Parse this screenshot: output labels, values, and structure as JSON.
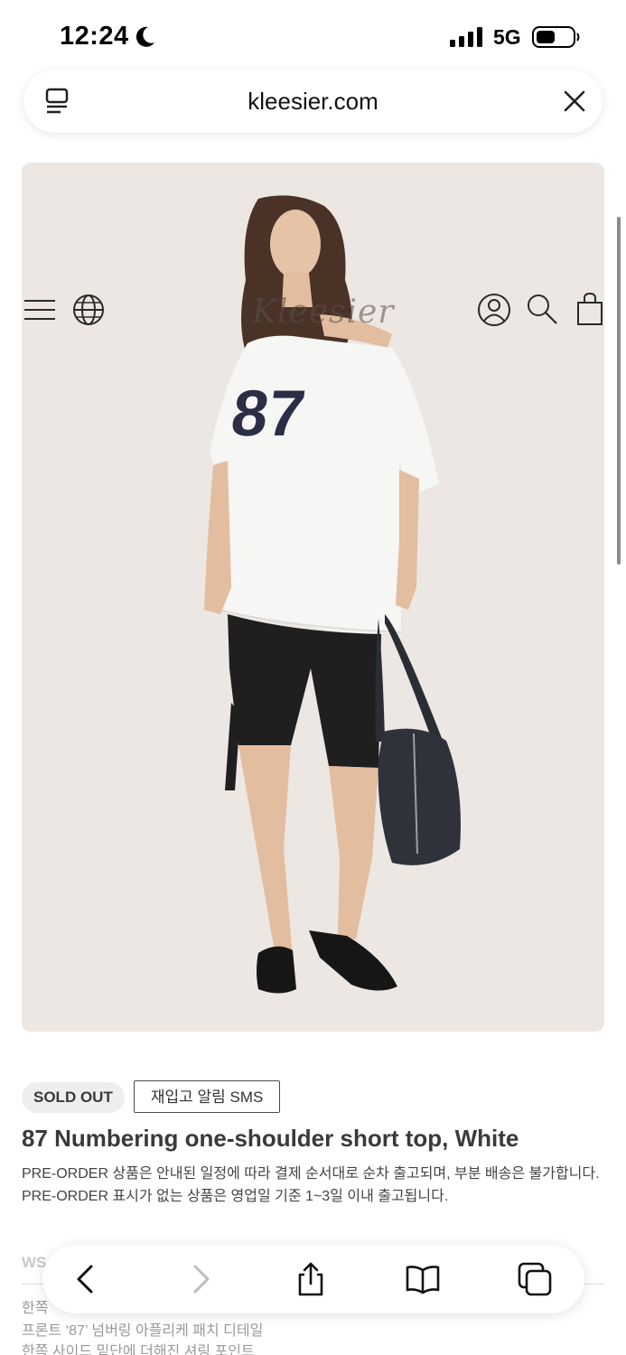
{
  "status": {
    "time": "12:24",
    "network": "5G",
    "icons": [
      "moon-icon",
      "signal-icon",
      "battery-icon"
    ]
  },
  "browser": {
    "url": "kleesier.com",
    "icons": [
      "reader-icon",
      "close-icon"
    ]
  },
  "site_header": {
    "logo": "Kleesier",
    "icons": [
      "menu-icon",
      "globe-icon",
      "account-icon",
      "search-icon",
      "bag-icon"
    ]
  },
  "product": {
    "badge": "SOLD OUT",
    "restock_button": "재입고 알림 SMS",
    "title": "87 Numbering one-shoulder short top, White",
    "notice": "PRE-ORDER 상품은 안내된 일정에 따라 결제 순서대로 순차 출고되며, 부분 배송은 불가합니다. PRE-ORDER 표시가 없는 상품은 영업일 기준 1~3일 이내 출고됩니다.",
    "section_label": "WS",
    "description_lines": [
      "한쪽",
      "프론트 ‘87’ 넘버링 아플리케 패치 디테일",
      "한쪽 사이드 밑단에 더해진 셔링 포인트"
    ],
    "shirt_number": "87"
  },
  "toolbar": {
    "icons": [
      "back-icon",
      "forward-icon",
      "share-icon",
      "bookmarks-icon",
      "tabs-icon"
    ]
  },
  "colors": {
    "hero_bg": "#ece7e2",
    "text_dark": "#3a3a3a",
    "navy_print": "#2b2e45"
  }
}
